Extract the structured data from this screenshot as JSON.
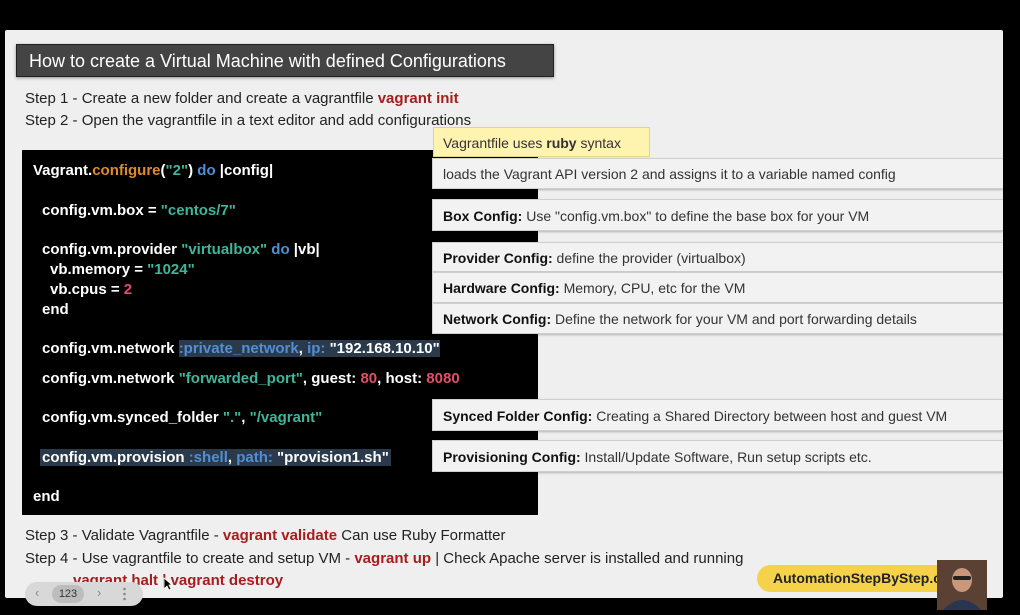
{
  "slide": {
    "title": "How to create a Virtual Machine with defined Configurations",
    "step1": {
      "text": "Step 1 - Create a new folder and create a vagrantfile ",
      "cmd": "vagrant init"
    },
    "step2": {
      "text": "Step 2 - Open the vagrantfile in a text editor and add configurations"
    },
    "step3": {
      "text": "Step 3 - Validate Vagrantfile - ",
      "cmd": "vagrant validate",
      "tail": " Can use Ruby Formatter"
    },
    "step4": {
      "text": "Step 4 - Use vagrantfile to create and setup VM - ",
      "cmd": "vagrant up",
      "tail": " | Check Apache server is installed and running"
    },
    "step5": {
      "cmd1": "vagrant halt",
      "sep": " | ",
      "cmd2": "vagrant destroy"
    }
  },
  "code": {
    "l1": {
      "a": "Vagrant.",
      "b": "configure",
      "c": "(",
      "d": "\"2\"",
      "e": ") ",
      "f": "do",
      "g": " |config|"
    },
    "l2": {
      "a": "config.vm.box = ",
      "b": "\"centos/7\""
    },
    "l3": {
      "a": "config.vm.provider ",
      "b": "\"virtualbox\"",
      "c": " do",
      "d": " |vb|"
    },
    "l4": {
      "a": "vb.memory = ",
      "b": "\"1024\""
    },
    "l5": {
      "a": "vb.cpus = ",
      "b": "2"
    },
    "l6": {
      "a": "end"
    },
    "l7": {
      "a": "config.vm.network ",
      "b": ":private_network",
      "c": ", ",
      "d": "ip:",
      "e": " \"192.168.10.10\""
    },
    "l8": {
      "a": "config.vm.network ",
      "b": "\"forwarded_port\"",
      "c": ", guest: ",
      "d": "80",
      "e": ", host: ",
      "f": "8080"
    },
    "l9": {
      "a": "config.vm.synced_folder ",
      "b": "\".\"",
      "c": ", ",
      "d": "\"/vagrant\""
    },
    "l10": {
      "a": "config.vm.provision ",
      "b": ":shell",
      "c": ", ",
      "d": "path:",
      "e": " \"provision1.sh\""
    },
    "l11": {
      "a": "end"
    }
  },
  "notes": {
    "ruby": {
      "pre": "Vagrantfile uses ",
      "bold": "ruby",
      "post": " syntax"
    },
    "api": {
      "text": "loads the Vagrant API version 2 and assigns it to a variable named config"
    },
    "box": {
      "label": "Box Config:",
      "text": " Use \"config.vm.box\" to define the base box for your VM"
    },
    "provider": {
      "label": "Provider Config:",
      "text": " define the provider (virtualbox)"
    },
    "hardware": {
      "label": "Hardware Config:",
      "text": " Memory, CPU, etc for the VM"
    },
    "network": {
      "label": "Network Config:",
      "text": " Define the network for your VM and port forwarding details"
    },
    "synced": {
      "label": "Synced Folder Config:",
      "text": " Creating a Shared Directory between host and guest VM"
    },
    "provision": {
      "label": "Provisioning Config:",
      "text": " Install/Update Software, Run setup scripts etc."
    }
  },
  "player": {
    "page_number": "123",
    "prev_arrow": "‹",
    "next_arrow": "›",
    "brand": "AutomationStepByStep.com"
  },
  "colors": {
    "command_red": "#a81c1c",
    "keyword_blue": "#4f8fd8",
    "string_teal": "#3fb59b",
    "method_orange": "#e08a2a",
    "number_pink": "#e04f6a",
    "brand_yellow": "#f5d24a"
  }
}
